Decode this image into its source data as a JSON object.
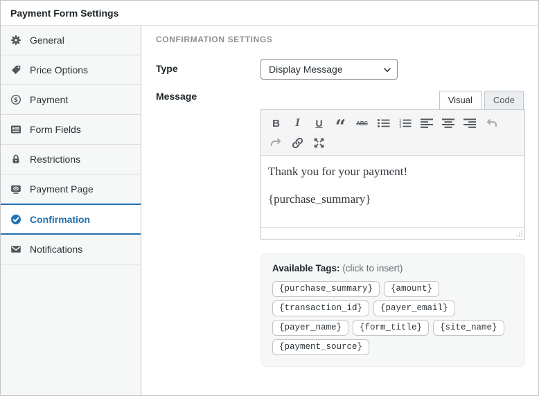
{
  "window": {
    "title": "Payment Form Settings"
  },
  "sidebar": {
    "items": [
      {
        "label": "General",
        "icon": "gear-icon",
        "active": false
      },
      {
        "label": "Price Options",
        "icon": "tag-icon",
        "active": false
      },
      {
        "label": "Payment",
        "icon": "dollar-circle-icon",
        "active": false
      },
      {
        "label": "Form Fields",
        "icon": "form-fields-icon",
        "active": false
      },
      {
        "label": "Restrictions",
        "icon": "lock-icon",
        "active": false
      },
      {
        "label": "Payment Page",
        "icon": "payment-page-icon",
        "active": false
      },
      {
        "label": "Confirmation",
        "icon": "check-circle-icon",
        "active": true
      },
      {
        "label": "Notifications",
        "icon": "envelope-icon",
        "active": false
      }
    ]
  },
  "main": {
    "section_heading": "CONFIRMATION SETTINGS",
    "type_label": "Type",
    "type_value": "Display Message",
    "message_label": "Message",
    "editor": {
      "tabs": {
        "visual": "Visual",
        "code": "Code"
      },
      "toolbar": {
        "bold": "B",
        "italic": "I",
        "underline": "U",
        "blockquote": "“",
        "strikethrough": "ABC"
      },
      "content_lines": [
        "Thank you for your payment!",
        "{purchase_summary}"
      ]
    },
    "tags": {
      "title": "Available Tags:",
      "hint": "(click to insert)",
      "items": [
        "{purchase_summary}",
        "{amount}",
        "{transaction_id}",
        "{payer_email}",
        "{payer_name}",
        "{form_title}",
        "{site_name}",
        "{payment_source}"
      ]
    }
  },
  "colors": {
    "accent": "#2271b1",
    "sidebar_bg": "#f6f7f7",
    "window_border": "#c3c4c7",
    "toolbar_bg": "#f5f5f5",
    "heading_gray": "#8c8f94"
  }
}
